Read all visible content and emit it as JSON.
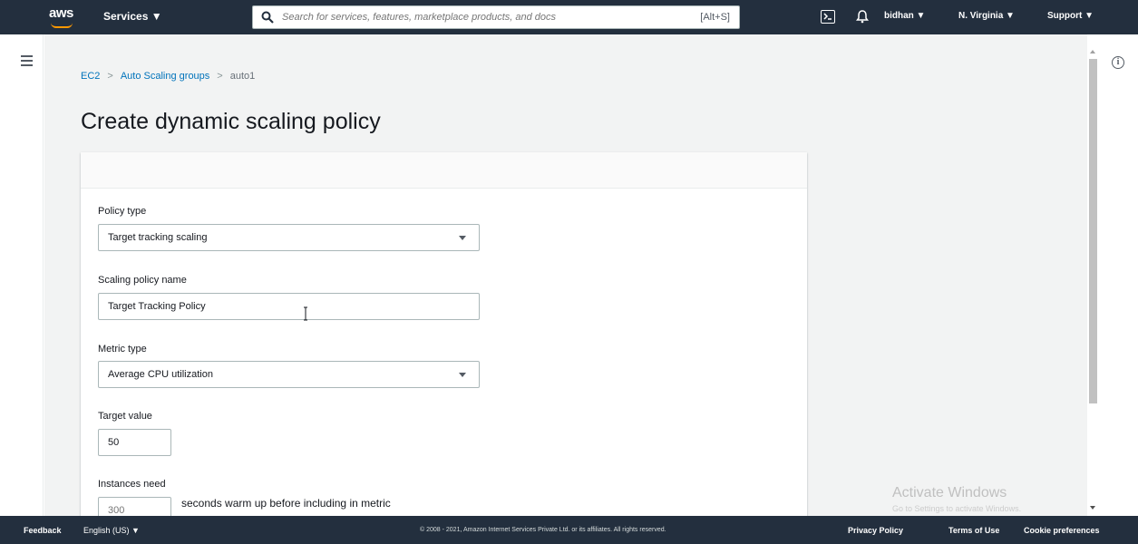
{
  "topnav": {
    "logo_text": "aws",
    "services_label": "Services ▼",
    "search_placeholder": "Search for services, features, marketplace products, and docs",
    "search_shortcut": "[Alt+S]",
    "user_menu": "bidhan ▼",
    "region_menu": "N. Virginia ▼",
    "support_menu": "Support ▼"
  },
  "breadcrumb": {
    "items": [
      "EC2",
      "Auto Scaling groups",
      "auto1"
    ],
    "separator": ">"
  },
  "page": {
    "title": "Create dynamic scaling policy"
  },
  "form": {
    "policy_type_label": "Policy type",
    "policy_type_value": "Target tracking scaling",
    "policy_name_label": "Scaling policy name",
    "policy_name_value": "Target Tracking Policy",
    "metric_type_label": "Metric type",
    "metric_type_value": "Average CPU utilization",
    "target_value_label": "Target value",
    "target_value": "50",
    "instances_need_label": "Instances need",
    "warmup_placeholder": "300",
    "warmup_suffix": "seconds warm up before including in metric"
  },
  "watermark": {
    "line1": "Activate Windows",
    "line2": "Go to Settings to activate Windows."
  },
  "footer": {
    "feedback": "Feedback",
    "language": "English (US) ▼",
    "copyright": "© 2008 - 2021, Amazon Internet Services Private Ltd. or its affiliates. All rights reserved.",
    "privacy": "Privacy Policy",
    "terms": "Terms of Use",
    "cookies": "Cookie preferences"
  },
  "colors": {
    "nav_bg": "#232f3e",
    "link": "#0073bb",
    "aws_orange": "#ff9900",
    "content_bg": "#f2f3f3"
  },
  "icons": [
    "search-icon",
    "cloudshell-icon",
    "bell-icon",
    "hamburger-icon",
    "info-icon",
    "caret-down-icon",
    "text-cursor-icon"
  ]
}
